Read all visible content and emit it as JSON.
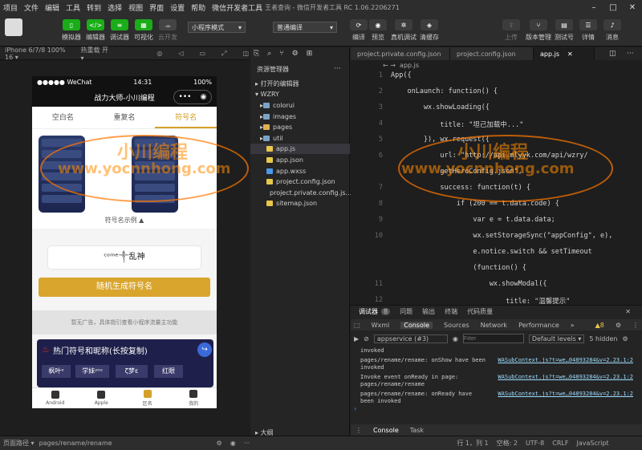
{
  "menu": [
    "项目",
    "文件",
    "编辑",
    "工具",
    "转到",
    "选择",
    "视图",
    "界面",
    "设置",
    "帮助",
    "微信开发者工具"
  ],
  "window_title": "王者查询 - 微信开发者工具 RC 1.06.2206271",
  "toolbar": {
    "left": [
      "模拟器",
      "编辑器",
      "调试器",
      "可视化",
      "云开发"
    ],
    "mode_select": "小程序模式",
    "compile_select": "普通编译",
    "mid": [
      "编译",
      "预览",
      "真机调试",
      "清缓存"
    ],
    "right": [
      "上传",
      "版本管理",
      "测试号",
      "详情",
      "消息"
    ]
  },
  "simbar": {
    "device": "iPhone 6/7/8 100% 16 ▾",
    "hot": "热重载 开 ▾"
  },
  "phone": {
    "carrier": "●●●●● WeChat",
    "time": "14:31",
    "battery": "100%",
    "nav_title": "战力大师-小川编程",
    "tabs": [
      "空白名",
      "重复名",
      "符号名"
    ],
    "example_label": "符号名示例 ▲",
    "input_value": "ᶜᵒᵐᵉ༒乱神",
    "generate_button": "随机生成符号名",
    "ad_text": "暂无广告，具体指引查看小程序流量主功能",
    "hot_title": "热门符号和昵称(长按复制)",
    "hot_tags": [
      "枫叶ᵒ",
      "学妹ʸᵒᵘ",
      "ζ梦ε",
      "红眼"
    ],
    "footer": [
      "Android",
      "Apple",
      "区名",
      "我的"
    ]
  },
  "explorer": {
    "header": "资源管理器",
    "open_editors": "▸ 打开的编辑器",
    "project": "▾ WZRY",
    "items": [
      {
        "name": "colorui",
        "type": "folder",
        "color": "#7aa3c8"
      },
      {
        "name": "images",
        "type": "folder",
        "color": "#7aa3c8"
      },
      {
        "name": "pages",
        "type": "folder",
        "color": "#e0b050"
      },
      {
        "name": "util",
        "type": "folder",
        "color": "#7aa3c8"
      },
      {
        "name": "app.js",
        "type": "js",
        "color": "#e8c84a"
      },
      {
        "name": "app.json",
        "type": "json",
        "color": "#e8c84a"
      },
      {
        "name": "app.wxss",
        "type": "wxss",
        "color": "#4a9ae8"
      },
      {
        "name": "project.config.json",
        "type": "json",
        "color": "#e8c84a"
      },
      {
        "name": "project.private.config.js...",
        "type": "json",
        "color": "#e8c84a"
      },
      {
        "name": "sitemap.json",
        "type": "json",
        "color": "#e8c84a"
      }
    ],
    "outline": "▸ 大纲"
  },
  "editor": {
    "tabs": [
      "project.private.config.json",
      "project.config.json",
      "app.js"
    ],
    "breadcrumb": "app.js",
    "lines": [
      {
        "n": "1",
        "t": "App({"
      },
      {
        "n": "2",
        "t": "    onLaunch: function() {"
      },
      {
        "n": "3",
        "t": "        wx.showLoading({"
      },
      {
        "n": "4",
        "t": "            title: \"坦己加载中...\""
      },
      {
        "n": "5",
        "t": "        }), wx.request({"
      },
      {
        "n": "6",
        "t": "            url: \"http://api.mlyyk.com/api/wzry/"
      },
      {
        "n": "",
        "t": "            getHeroConfig.json\","
      },
      {
        "n": "7",
        "t": "            success: function(t) {"
      },
      {
        "n": "8",
        "t": "                if (200 == t.data.code) {"
      },
      {
        "n": "9",
        "t": "                    var e = t.data.data;"
      },
      {
        "n": "10",
        "t": "                    wx.setStorageSync(\"appConfig\", e),"
      },
      {
        "n": "",
        "t": "                    e.notice.switch && setTimeout"
      },
      {
        "n": "",
        "t": "                    (function() {"
      },
      {
        "n": "11",
        "t": "                        wx.showModal({"
      },
      {
        "n": "12",
        "t": "                            title: \"温馨提示\""
      }
    ]
  },
  "devtools": {
    "tabs": [
      "调试器",
      "8",
      "问题",
      "输出",
      "终端",
      "代码质量"
    ],
    "panel_tabs": [
      "Wxml",
      "Console",
      "Sources",
      "Network",
      "Performance",
      "»"
    ],
    "warn_count": "▲8",
    "context": "appservice (#3)",
    "filter_placeholder": "Filter",
    "levels": "Default levels ▾",
    "hidden": "5 hidden",
    "logs": [
      {
        "text": "invoked",
        "src": ""
      },
      {
        "text": "pages/rename/rename: onShow have been\ninvoked",
        "src": "WASubContext.js?t=we…04893284&v=2.23.1:2"
      },
      {
        "text": "Invoke event onReady in page:\npages/rename/rename",
        "src": "WASubContext.js?t=we…04893284&v=2.23.1:2"
      },
      {
        "text": "pages/rename/rename: onReady have\nbeen invoked",
        "src": "WASubContext.js?t=we…04893284&v=2.23.1:2"
      }
    ],
    "bottom_tabs": [
      "Console",
      "Task"
    ]
  },
  "status": {
    "path_label": "页面路径 ▾",
    "path": "pages/rename/rename",
    "pos": "行 1，列 1",
    "space": "空格: 2",
    "enc": "UTF-8",
    "eol": "CRLF",
    "lang": "JavaScript"
  },
  "watermark": {
    "cn": "小川编程",
    "url": "www.yocnnhong.com"
  }
}
